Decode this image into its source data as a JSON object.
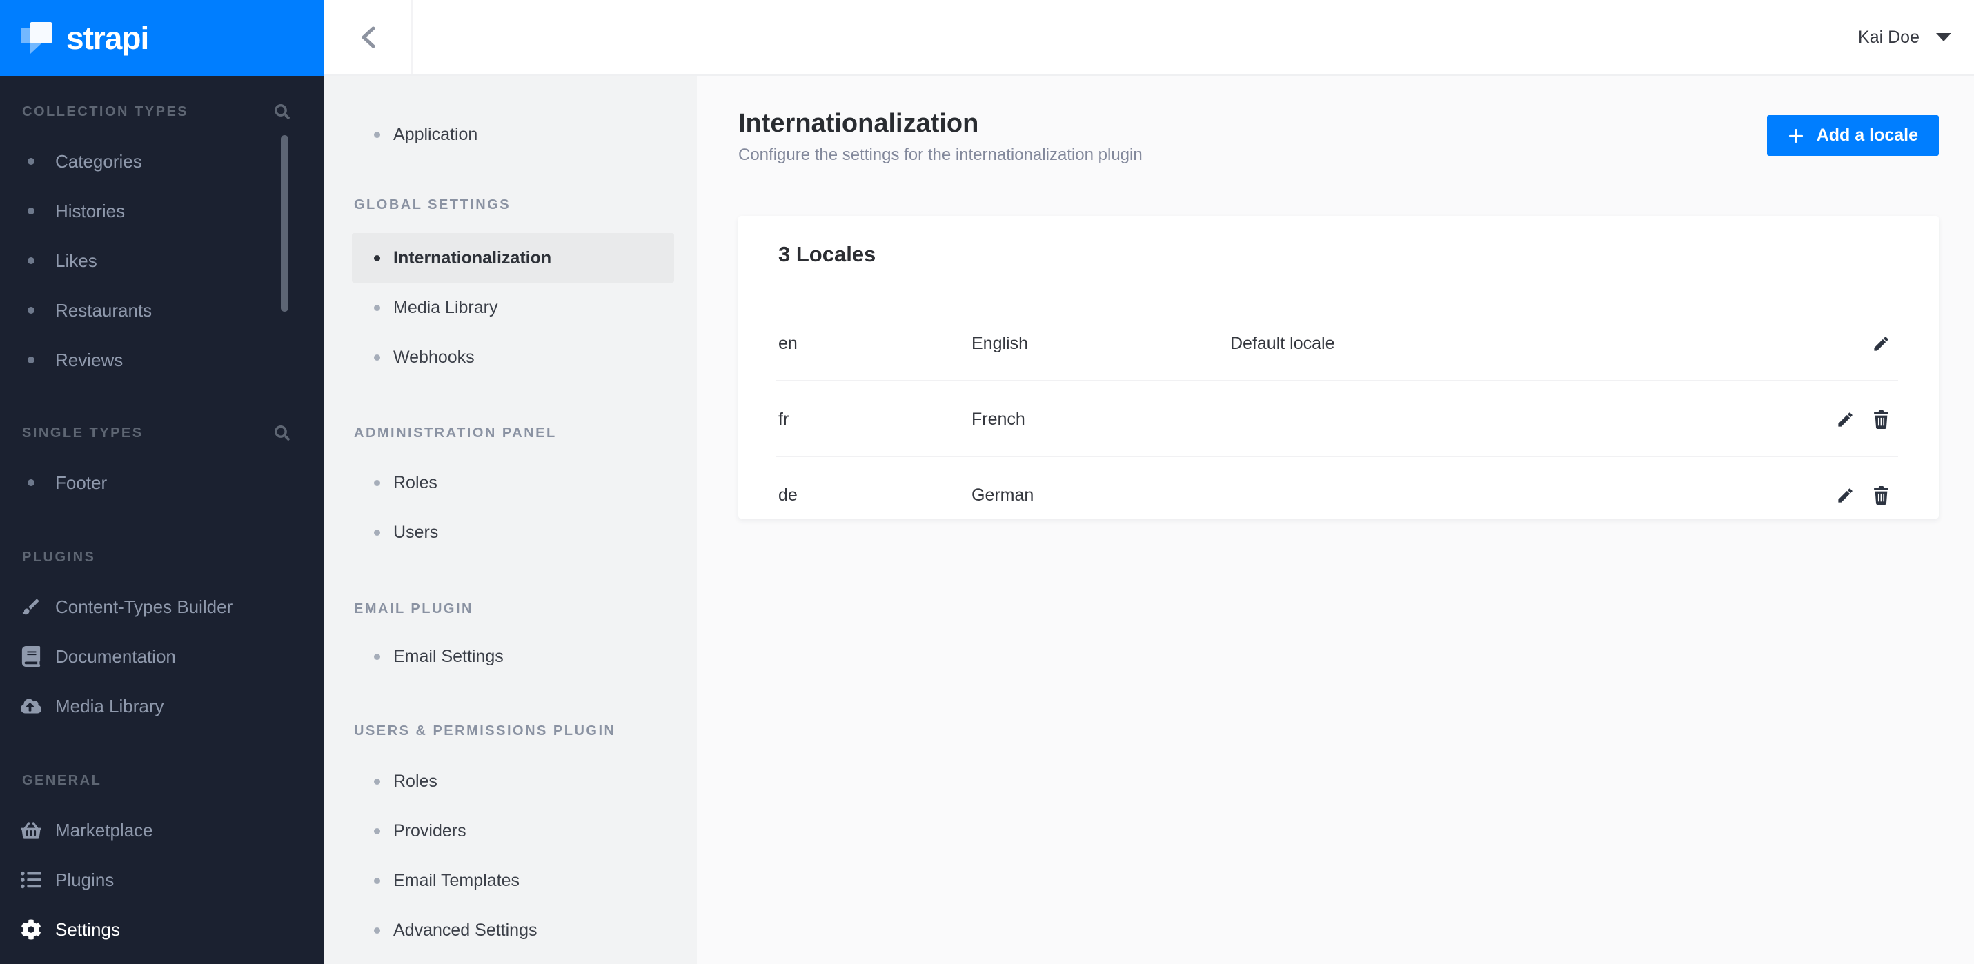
{
  "colors": {
    "accent_blue": "#007eff",
    "sidebar_dark": "#1b2130",
    "sub_sidebar_bg": "#f2f3f4",
    "main_bg": "#fafafb"
  },
  "brand": {
    "logo_text": "strapi"
  },
  "topbar": {
    "user_name": "Kai Doe"
  },
  "nav": {
    "sections": [
      {
        "label": "COLLECTION TYPES",
        "has_search": true,
        "items": [
          {
            "label": "Categories"
          },
          {
            "label": "Histories"
          },
          {
            "label": "Likes"
          },
          {
            "label": "Restaurants"
          },
          {
            "label": "Reviews"
          }
        ]
      },
      {
        "label": "SINGLE TYPES",
        "has_search": true,
        "items": [
          {
            "label": "Footer"
          }
        ]
      },
      {
        "label": "PLUGINS",
        "has_search": false,
        "items": [
          {
            "label": "Content-Types Builder",
            "icon": "brush-icon"
          },
          {
            "label": "Documentation",
            "icon": "book-icon"
          },
          {
            "label": "Media Library",
            "icon": "cloud-upload-icon"
          }
        ]
      },
      {
        "label": "GENERAL",
        "has_search": false,
        "items": [
          {
            "label": "Marketplace",
            "icon": "basket-icon"
          },
          {
            "label": "Plugins",
            "icon": "list-icon"
          },
          {
            "label": "Settings",
            "icon": "gear-icon",
            "active": true
          }
        ]
      }
    ]
  },
  "settings_nav": {
    "standalone": {
      "label": "Application"
    },
    "sections": [
      {
        "label": "GLOBAL SETTINGS",
        "items": [
          {
            "label": "Internationalization",
            "active": true
          },
          {
            "label": "Media Library"
          },
          {
            "label": "Webhooks"
          }
        ]
      },
      {
        "label": "ADMINISTRATION PANEL",
        "items": [
          {
            "label": "Roles"
          },
          {
            "label": "Users"
          }
        ]
      },
      {
        "label": "EMAIL PLUGIN",
        "items": [
          {
            "label": "Email Settings"
          }
        ]
      },
      {
        "label": "USERS & PERMISSIONS PLUGIN",
        "items": [
          {
            "label": "Roles"
          },
          {
            "label": "Providers"
          },
          {
            "label": "Email Templates"
          },
          {
            "label": "Advanced Settings"
          }
        ]
      }
    ]
  },
  "page": {
    "title": "Internationalization",
    "subtitle": "Configure the settings for the internationalization plugin",
    "add_button_label": "Add a locale",
    "card": {
      "title": "3 Locales",
      "rows": [
        {
          "code": "en",
          "name": "English",
          "note": "Default locale"
        },
        {
          "code": "fr",
          "name": "French",
          "note": ""
        },
        {
          "code": "de",
          "name": "German",
          "note": ""
        }
      ]
    }
  }
}
